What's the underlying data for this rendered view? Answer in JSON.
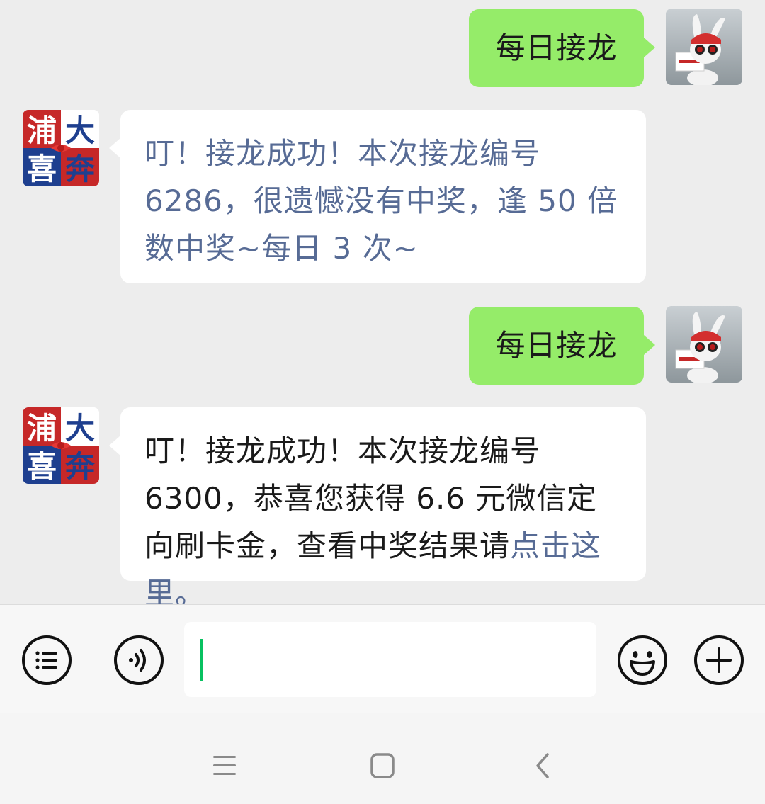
{
  "messages": [
    {
      "side": "me",
      "text": "每日接龙",
      "avatar_icon": "rabbit-avatar-icon"
    },
    {
      "side": "bot",
      "text": "叮！接龙成功！本次接龙编号6286，很遗憾没有中奖，逢 50 倍数中奖~每日 3 次~",
      "avatar_icon": "pufa-logo-avatar-icon",
      "avatar_text": [
        "浦",
        "大",
        "喜",
        "奔"
      ]
    },
    {
      "side": "me",
      "text": "每日接龙",
      "avatar_icon": "rabbit-avatar-icon"
    },
    {
      "side": "bot",
      "text_before_link": "叮！接龙成功！本次接龙编号6300，恭喜您获得 6.6 元微信定向刷卡金，查看中奖结果请",
      "link_text": "点击这里。",
      "avatar_icon": "pufa-logo-avatar-icon",
      "avatar_text": [
        "浦",
        "大",
        "喜",
        "奔"
      ]
    }
  ],
  "input_bar": {
    "menu_icon": "list-menu-icon",
    "voice_icon": "voice-icon",
    "emoji_icon": "emoji-icon",
    "plus_icon": "plus-icon",
    "input_value": ""
  },
  "nav_bar": {
    "menu_icon": "hamburger-icon",
    "home_icon": "square-home-icon",
    "back_icon": "back-chevron-icon"
  },
  "colors": {
    "background": "#ededed",
    "my_bubble": "#95ec69",
    "bot_bubble": "#ffffff",
    "link": "#576b95",
    "cursor": "#07c160"
  }
}
